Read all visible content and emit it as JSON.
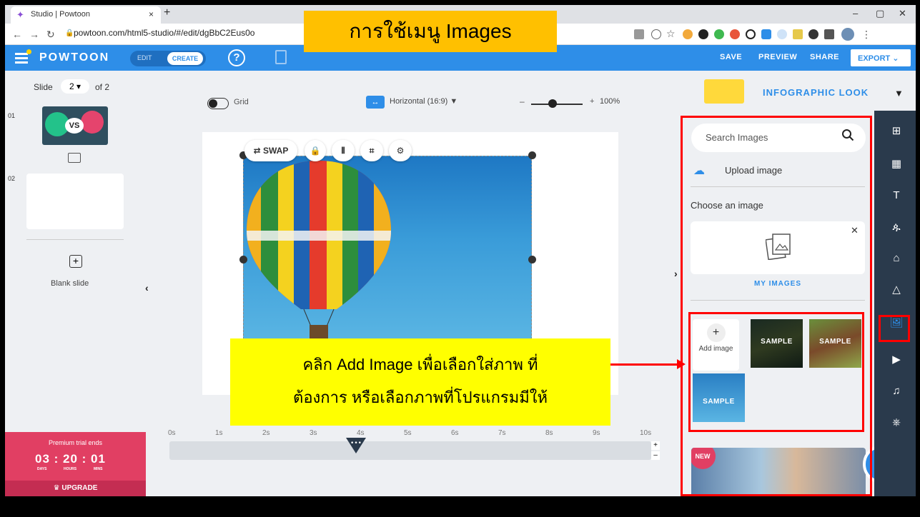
{
  "browser": {
    "tab_title": "Studio | Powtoon",
    "tab_close": "×",
    "new_tab": "+",
    "url": "powtoon.com/html5-studio/#/edit/dgBbC2Eus0o",
    "minimize": "–",
    "maximize": "▢",
    "close": "✕"
  },
  "header": {
    "logo": "POWTOON",
    "edit_label": "EDIT",
    "create_label": "CREATE",
    "help": "?",
    "save": "SAVE",
    "preview": "PREVIEW",
    "share": "SHARE",
    "export": "EXPORT ⌄",
    "accent_color": "#2e8ee8"
  },
  "slides": {
    "label_prefix": "Slide",
    "current": "2 ▾",
    "label_suffix": "of 2",
    "items": [
      {
        "number": "01",
        "thumb_text": "VS"
      },
      {
        "number": "02",
        "thumb_text": ""
      }
    ],
    "blank_icon": "+",
    "blank_label": "Blank slide",
    "collapse": "‹"
  },
  "premium": {
    "title": "Premium trial ends",
    "timer": "03 : 20 : 01",
    "days": "DAYS",
    "hours": "HOURS",
    "mins": "MINS",
    "upgrade": "UPGRADE"
  },
  "canvas": {
    "grid_label": "Grid",
    "orientation_icon": "↔",
    "orientation_label": "Horizontal (16:9) ▼",
    "zoom_minus": "–",
    "zoom_plus": "+",
    "zoom": "100%",
    "toolbar": {
      "swap": "⇄ SWAP",
      "lock": "🔒",
      "flip": "⫴",
      "crop": "⌗",
      "settings": "⚙"
    },
    "right_collapse": "›"
  },
  "timeline": {
    "ticks": [
      "0s",
      "1s",
      "2s",
      "3s",
      "4s",
      "5s",
      "6s",
      "7s",
      "8s",
      "9s",
      "10s"
    ],
    "playhead": "•••",
    "plus": "+",
    "minus": "–"
  },
  "right_panel": {
    "look_label": "INFOGRAPHIC LOOK",
    "look_arrow": "▼",
    "search_placeholder": "Search Images",
    "upload_label": "Upload image",
    "choose_label": "Choose an image",
    "my_images_close": "✕",
    "my_images_label": "MY IMAGES",
    "add_image": "+",
    "add_image_label": "Add image",
    "samples": [
      "SAMPLE",
      "SAMPLE",
      "SAMPLE"
    ],
    "new_badge": "NEW",
    "help": "?"
  },
  "rail": {
    "icons": [
      "layout-icon",
      "background-icon",
      "text-icon",
      "characters-icon",
      "props-icon",
      "shapes-icon",
      "images-icon",
      "video-icon",
      "music-icon",
      "specials-icon"
    ],
    "glyphs": [
      "⊞",
      "▦",
      "T",
      "ዹ",
      "⌂",
      "△",
      "🖼",
      "▶",
      "♫",
      "⎈"
    ]
  },
  "annotations": {
    "title": "การใช้เมนู Images",
    "instruction_line1": "คลิก Add Image เพื่อเลือกใส่ภาพ ที่",
    "instruction_line2": "ต้องการ หรือเลือกภาพที่โปรแกรมมีให้",
    "highlight_color": "#ff0000"
  }
}
